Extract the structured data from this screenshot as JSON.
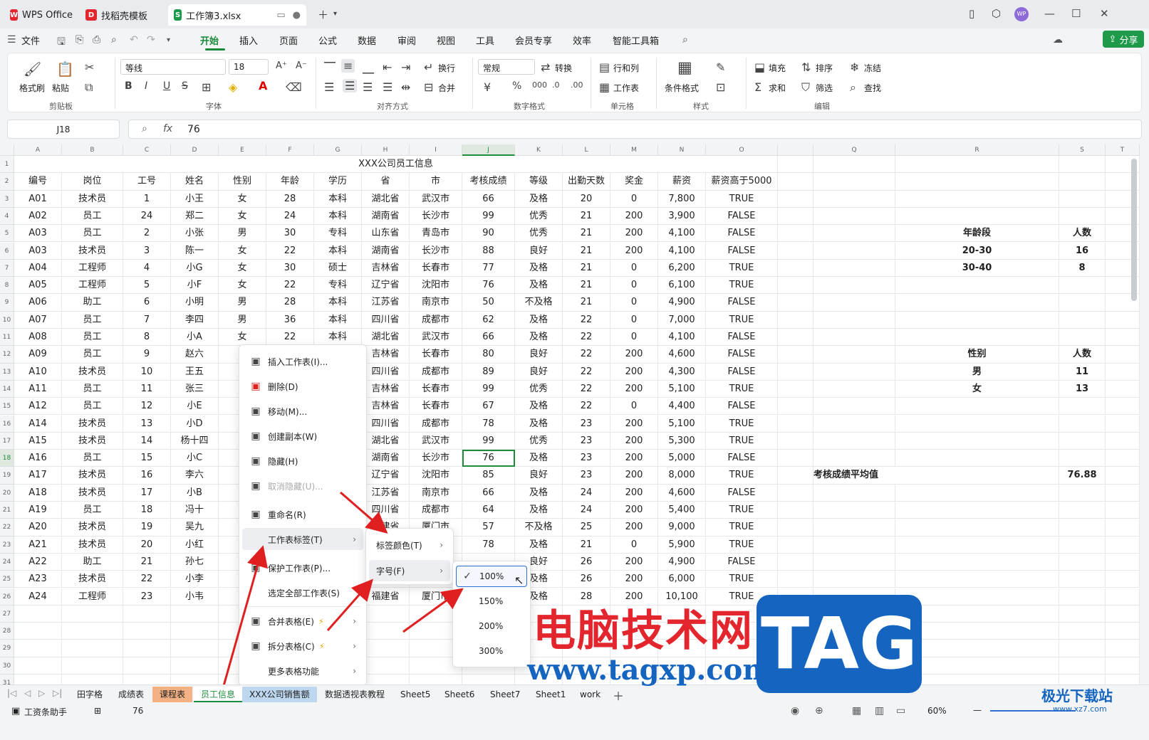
{
  "tabs": [
    {
      "label": "WPS Office"
    },
    {
      "label": "找稻壳模板"
    },
    {
      "label": "工作簿3.xlsx"
    }
  ],
  "menubar": {
    "file": "文件",
    "items": [
      "开始",
      "插入",
      "页面",
      "公式",
      "数据",
      "审阅",
      "视图",
      "工具",
      "会员专享",
      "效率",
      "智能工具箱"
    ],
    "share": "分享"
  },
  "ribbon": {
    "clipboard": {
      "format_painter": "格式刷",
      "paste": "粘贴",
      "group": "剪贴板"
    },
    "font": {
      "name": "等线",
      "size": "18",
      "group": "字体"
    },
    "align": {
      "wrap": "换行",
      "merge": "合并",
      "group": "对齐方式"
    },
    "number": {
      "format": "常规",
      "convert": "转换",
      "group": "数字格式"
    },
    "cells": {
      "rowcol": "行和列",
      "sheet": "工作表",
      "group": "单元格"
    },
    "styles": {
      "cond": "条件格式",
      "group": "样式"
    },
    "edit": {
      "fill": "填充",
      "sort": "排序",
      "freeze": "冻结",
      "sum": "求和",
      "filter": "筛选",
      "find": "查找",
      "group": "编辑"
    }
  },
  "formula": {
    "cell": "J18",
    "fx": "fx",
    "value": "76"
  },
  "columns": [
    "A",
    "B",
    "C",
    "D",
    "E",
    "F",
    "G",
    "H",
    "I",
    "J",
    "K",
    "L",
    "M",
    "N",
    "O",
    "",
    "Q",
    "R",
    "S",
    "T"
  ],
  "sheet_title": "XXX公司员工信息",
  "headers": [
    "编号",
    "岗位",
    "工号",
    "姓名",
    "性别",
    "年龄",
    "学历",
    "省",
    "市",
    "考核成绩",
    "等级",
    "出勤天数",
    "奖金",
    "薪资",
    "薪资高于5000"
  ],
  "rows": [
    [
      "A01",
      "技术员",
      "1",
      "小王",
      "女",
      "28",
      "本科",
      "湖北省",
      "武汉市",
      "66",
      "及格",
      "20",
      "0",
      "7,800",
      "TRUE"
    ],
    [
      "A02",
      "员工",
      "24",
      "郑二",
      "女",
      "24",
      "本科",
      "湖南省",
      "长沙市",
      "99",
      "优秀",
      "21",
      "200",
      "3,900",
      "FALSE"
    ],
    [
      "A03",
      "员工",
      "2",
      "小张",
      "男",
      "30",
      "专科",
      "山东省",
      "青岛市",
      "90",
      "优秀",
      "21",
      "200",
      "4,100",
      "FALSE"
    ],
    [
      "A03",
      "技术员",
      "3",
      "陈一",
      "女",
      "22",
      "本科",
      "湖南省",
      "长沙市",
      "88",
      "良好",
      "21",
      "200",
      "4,100",
      "FALSE"
    ],
    [
      "A04",
      "工程师",
      "4",
      "小G",
      "女",
      "30",
      "硕士",
      "吉林省",
      "长春市",
      "77",
      "及格",
      "21",
      "0",
      "6,200",
      "TRUE"
    ],
    [
      "A05",
      "工程师",
      "5",
      "小F",
      "女",
      "22",
      "专科",
      "辽宁省",
      "沈阳市",
      "76",
      "及格",
      "21",
      "0",
      "6,100",
      "TRUE"
    ],
    [
      "A06",
      "助工",
      "6",
      "小明",
      "男",
      "28",
      "本科",
      "江苏省",
      "南京市",
      "50",
      "不及格",
      "21",
      "0",
      "4,900",
      "FALSE"
    ],
    [
      "A07",
      "员工",
      "7",
      "李四",
      "男",
      "36",
      "本科",
      "四川省",
      "成都市",
      "62",
      "及格",
      "22",
      "0",
      "7,000",
      "TRUE"
    ],
    [
      "A08",
      "员工",
      "8",
      "小A",
      "女",
      "22",
      "本科",
      "湖北省",
      "武汉市",
      "66",
      "及格",
      "22",
      "0",
      "4,100",
      "FALSE"
    ],
    [
      "A09",
      "员工",
      "9",
      "赵六",
      "",
      "",
      "",
      "吉林省",
      "长春市",
      "80",
      "良好",
      "22",
      "200",
      "4,600",
      "FALSE"
    ],
    [
      "A10",
      "技术员",
      "10",
      "王五",
      "",
      "",
      "",
      "四川省",
      "成都市",
      "89",
      "良好",
      "22",
      "200",
      "4,300",
      "FALSE"
    ],
    [
      "A11",
      "员工",
      "11",
      "张三",
      "",
      "",
      "",
      "吉林省",
      "长春市",
      "99",
      "优秀",
      "22",
      "200",
      "5,100",
      "TRUE"
    ],
    [
      "A12",
      "员工",
      "12",
      "小E",
      "",
      "",
      "",
      "吉林省",
      "长春市",
      "67",
      "及格",
      "22",
      "0",
      "4,400",
      "FALSE"
    ],
    [
      "A14",
      "技术员",
      "13",
      "小D",
      "",
      "",
      "",
      "四川省",
      "成都市",
      "78",
      "及格",
      "23",
      "200",
      "5,100",
      "TRUE"
    ],
    [
      "A15",
      "技术员",
      "14",
      "杨十四",
      "",
      "",
      "",
      "湖北省",
      "武汉市",
      "99",
      "优秀",
      "23",
      "200",
      "5,300",
      "TRUE"
    ],
    [
      "A16",
      "员工",
      "15",
      "小C",
      "",
      "",
      "",
      "湖南省",
      "长沙市",
      "76",
      "及格",
      "23",
      "200",
      "5,000",
      "FALSE"
    ],
    [
      "A17",
      "技术员",
      "16",
      "李六",
      "",
      "",
      "",
      "辽宁省",
      "沈阳市",
      "85",
      "良好",
      "23",
      "200",
      "8,000",
      "TRUE"
    ],
    [
      "A18",
      "技术员",
      "17",
      "小B",
      "",
      "",
      "",
      "江苏省",
      "南京市",
      "66",
      "及格",
      "24",
      "200",
      "4,600",
      "FALSE"
    ],
    [
      "A19",
      "员工",
      "18",
      "冯十",
      "",
      "",
      "",
      "四川省",
      "成都市",
      "64",
      "及格",
      "24",
      "200",
      "5,400",
      "TRUE"
    ],
    [
      "A20",
      "技术员",
      "19",
      "吴九",
      "",
      "",
      "",
      "福建省",
      "厦门市",
      "57",
      "不及格",
      "25",
      "200",
      "9,000",
      "TRUE"
    ],
    [
      "A21",
      "技术员",
      "20",
      "小红",
      "",
      "",
      "",
      "",
      "",
      "78",
      "及格",
      "21",
      "0",
      "5,900",
      "TRUE"
    ],
    [
      "A22",
      "助工",
      "21",
      "孙七",
      "",
      "",
      "",
      "",
      "",
      "",
      "良好",
      "26",
      "200",
      "4,900",
      "FALSE"
    ],
    [
      "A23",
      "技术员",
      "22",
      "小李",
      "",
      "",
      "",
      "",
      "",
      "",
      "及格",
      "26",
      "200",
      "6,000",
      "TRUE"
    ],
    [
      "A24",
      "工程师",
      "23",
      "小韦",
      "",
      "",
      "",
      "福建省",
      "厦门市",
      "",
      "及格",
      "28",
      "200",
      "10,100",
      "TRUE"
    ]
  ],
  "side_tables": {
    "age_header": [
      "年龄段",
      "人数"
    ],
    "age_rows": [
      [
        "20-30",
        "16"
      ],
      [
        "30-40",
        "8"
      ]
    ],
    "gender_header": [
      "性别",
      "人数"
    ],
    "gender_rows": [
      [
        "男",
        "11"
      ],
      [
        "女",
        "13"
      ]
    ],
    "avg": [
      "考核成绩平均值",
      "76.88"
    ]
  },
  "context_menu": [
    {
      "label": "插入工作表(I)...",
      "icon": "insert-sheet-icon"
    },
    {
      "label": "删除(D)",
      "icon": "delete-icon"
    },
    {
      "label": "移动(M)...",
      "icon": "move-icon"
    },
    {
      "label": "创建副本(W)",
      "icon": "copy-icon"
    },
    {
      "label": "隐藏(H)",
      "icon": "hide-icon"
    },
    {
      "label": "取消隐藏(U)...",
      "icon": "unhide-icon",
      "disabled": true
    },
    {
      "label": "重命名(R)",
      "icon": "rename-icon"
    },
    {
      "label": "工作表标签(T)",
      "icon": "",
      "submenu": true
    },
    {
      "label": "保护工作表(P)...",
      "icon": "protect-icon"
    },
    {
      "label": "选定全部工作表(S)",
      "icon": ""
    },
    {
      "label": "合并表格(E)",
      "icon": "merge-table-icon",
      "submenu": true
    },
    {
      "label": "拆分表格(C)",
      "icon": "split-table-icon",
      "submenu": true
    },
    {
      "label": "更多表格功能",
      "icon": "",
      "submenu": true
    }
  ],
  "submenu1": [
    {
      "label": "标签颜色(T)"
    },
    {
      "label": "字号(F)"
    }
  ],
  "submenu2": [
    {
      "label": "100%",
      "checked": true
    },
    {
      "label": "150%"
    },
    {
      "label": "200%"
    },
    {
      "label": "300%"
    }
  ],
  "sheet_tabs": [
    {
      "label": "田字格"
    },
    {
      "label": "成绩表"
    },
    {
      "label": "课程表",
      "color": "#f4b183"
    },
    {
      "label": "员工信息",
      "active": true
    },
    {
      "label": "XXX公司销售额",
      "color": "#bdd7ee"
    },
    {
      "label": "数据透视表教程"
    },
    {
      "label": "Sheet5"
    },
    {
      "label": "Sheet6"
    },
    {
      "label": "Sheet7"
    },
    {
      "label": "Sheet1"
    },
    {
      "label": "work"
    }
  ],
  "status": {
    "assistant": "工资条助手",
    "value": "76",
    "zoom": "60%"
  },
  "watermark": {
    "cn": "电脑技术网",
    "url": "www.tagxp.com",
    "tag": "TAG",
    "logo": "极光下载站",
    "logo_url": "www.xz7.com"
  }
}
